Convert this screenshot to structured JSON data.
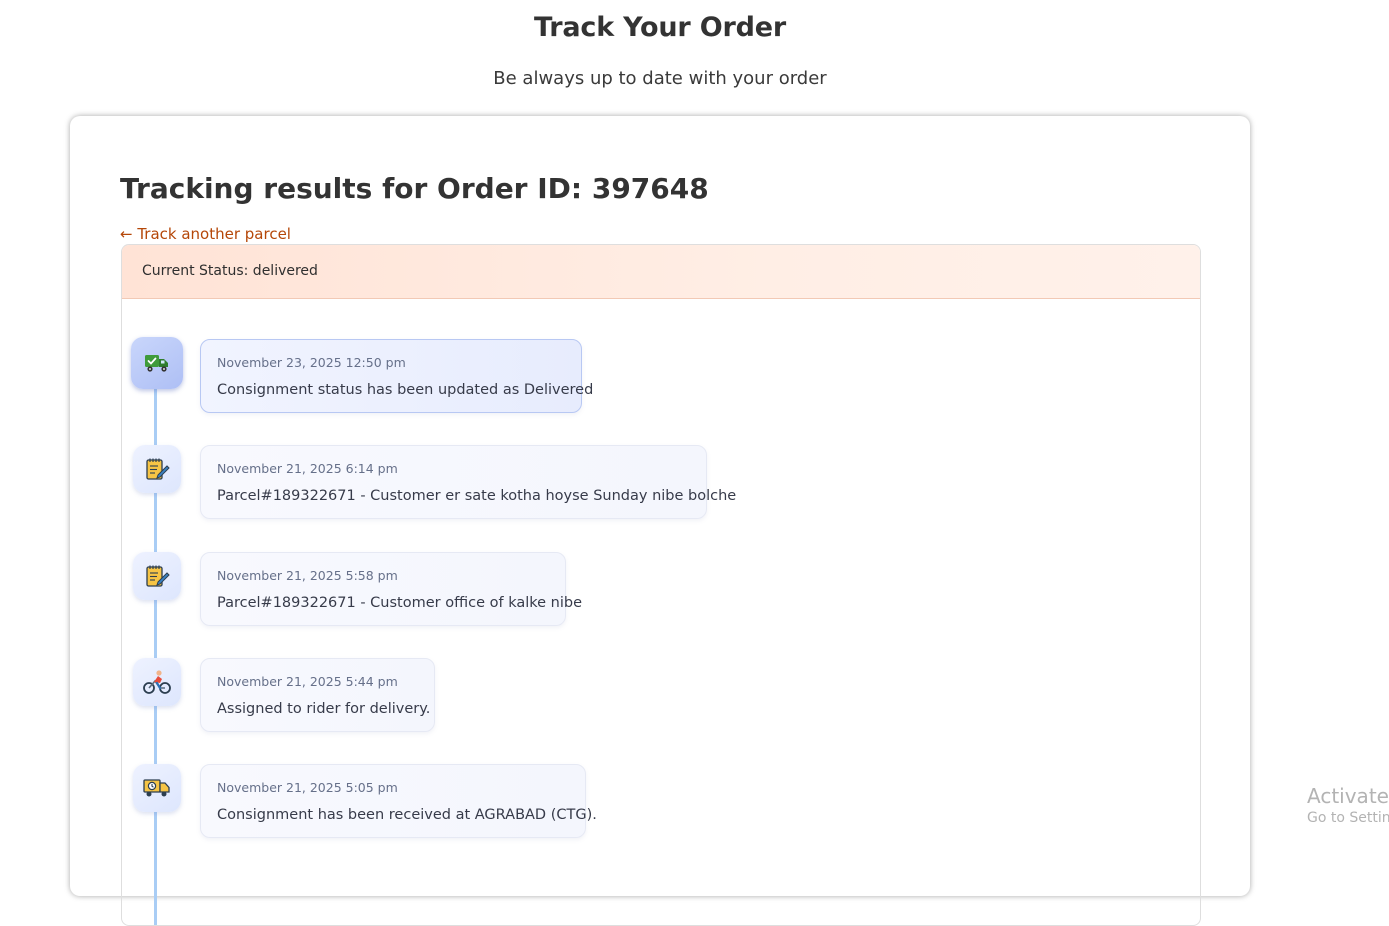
{
  "header": {
    "title": "Track Your Order",
    "subtitle": "Be always up to date with your order"
  },
  "results": {
    "title": "Tracking results for Order ID: 397648",
    "back_link": "← Track another parcel",
    "status_text": "Current Status: delivered"
  },
  "timeline": [
    {
      "icon": "delivered-truck-icon",
      "date": "November 23, 2025 12:50 pm",
      "message": "Consignment status has been updated as Delivered",
      "active": true
    },
    {
      "icon": "notepad-icon",
      "date": "November 21, 2025 6:14 pm",
      "message": "Parcel#189322671 - Customer er sate kotha hoyse Sunday nibe bolche",
      "active": false
    },
    {
      "icon": "notepad-icon",
      "date": "November 21, 2025 5:58 pm",
      "message": "Parcel#189322671 - Customer office of kalke nibe",
      "active": false
    },
    {
      "icon": "cyclist-icon",
      "date": "November 21, 2025 5:44 pm",
      "message": "Assigned to rider for delivery.",
      "active": false
    },
    {
      "icon": "received-truck-icon",
      "date": "November 21, 2025 5:05 pm",
      "message": "Consignment has been received at AGRABAD (CTG).",
      "active": false
    }
  ],
  "watermark": {
    "title": "Activate W",
    "subtitle": "Go to Setting"
  },
  "colors": {
    "link": "#b54708",
    "status_bar": "#ffe3d6",
    "timeline_line": "#a9cdf5"
  }
}
